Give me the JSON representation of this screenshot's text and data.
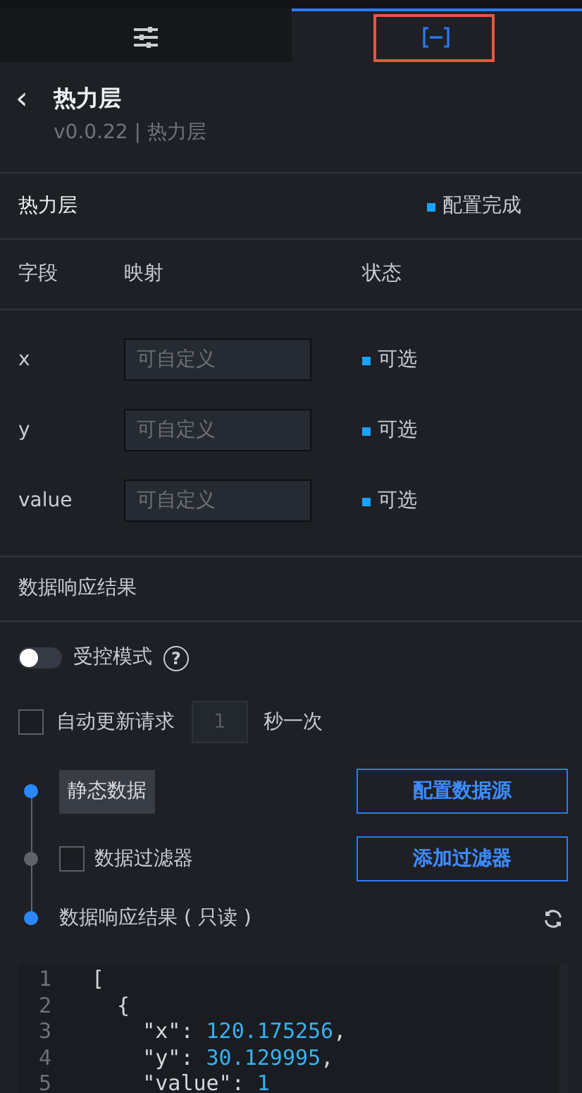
{
  "tabs": [
    {
      "kind": "sliders",
      "selected": false
    },
    {
      "kind": "brackets",
      "selected": true,
      "highlighted": true
    }
  ],
  "header": {
    "back": "‹",
    "title": "热力层",
    "subtitle": "v0.0.22 | 热力层"
  },
  "layer": {
    "name": "热力层",
    "status": "配置完成"
  },
  "fields": {
    "columns": [
      "字段",
      "映射",
      "状态"
    ],
    "rows": [
      {
        "name": "x",
        "placeholder": "可自定义",
        "status": "可选"
      },
      {
        "name": "y",
        "placeholder": "可自定义",
        "status": "可选"
      },
      {
        "name": "value",
        "placeholder": "可自定义",
        "status": "可选"
      }
    ]
  },
  "section_title": "数据响应结果",
  "controlled_mode": {
    "label": "受控模式",
    "on": false,
    "help": "?"
  },
  "auto_update": {
    "label": "自动更新请求",
    "checked": false,
    "interval_placeholder": "1",
    "unit": "秒一次"
  },
  "steps": [
    {
      "kind": "tag",
      "active": true,
      "label": "静态数据",
      "button": "配置数据源"
    },
    {
      "kind": "checkbox",
      "active": false,
      "label": "数据过滤器",
      "checked": false,
      "button": "添加过滤器"
    },
    {
      "kind": "title",
      "active": true,
      "label": "数据响应结果 ( 只读 )"
    }
  ],
  "code": {
    "lines": [
      [
        "1",
        "["
      ],
      [
        "2",
        "  {"
      ],
      [
        "3",
        "    \"x\": 120.175256,"
      ],
      [
        "4",
        "    \"y\": 30.129995,"
      ],
      [
        "5",
        "    \"value\": 1"
      ]
    ]
  }
}
